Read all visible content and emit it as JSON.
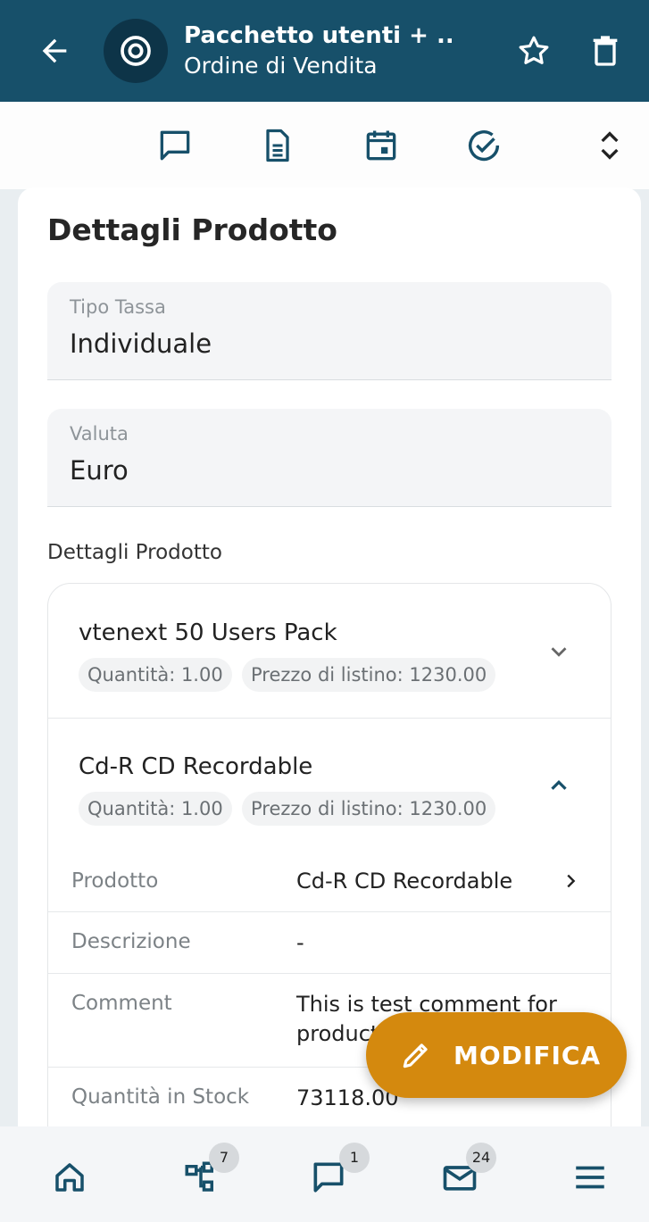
{
  "header": {
    "title": "Pacchetto utenti + ...",
    "subtitle": "Ordine di Vendita",
    "icons": {
      "back": "arrow-left-icon",
      "module": "target-icon",
      "favorite": "star-outline-icon",
      "delete": "trash-icon"
    }
  },
  "toolbar": {
    "icons": [
      "comment-icon",
      "document-icon",
      "calendar-icon",
      "check-circle-icon",
      "expand-collapse-icon"
    ]
  },
  "card": {
    "title": "Dettagli Prodotto",
    "fields": [
      {
        "label": "Tipo Tassa",
        "value": "Individuale"
      },
      {
        "label": "Valuta",
        "value": "Euro"
      }
    ],
    "section_label": "Dettagli Prodotto",
    "products": [
      {
        "name": "vtenext 50 Users Pack",
        "quantity": "Quantità: 1.00",
        "price": "Prezzo di listino: 1230.00",
        "expanded": false
      },
      {
        "name": "Cd-R CD Recordable",
        "quantity": "Quantità: 1.00",
        "price": "Prezzo di listino: 1230.00",
        "expanded": true
      }
    ],
    "details": [
      {
        "label": "Prodotto",
        "value": "Cd-R CD Recordable"
      },
      {
        "label": "Descrizione",
        "value": "-"
      },
      {
        "label": "Comment",
        "value": "This is test comment for product"
      },
      {
        "label": "Quantità in Stock",
        "value": "73118.00"
      }
    ]
  },
  "fab": {
    "label": "MODIFICA",
    "icon": "pencil-icon"
  },
  "bottom_nav": [
    {
      "icon": "home-icon",
      "badge": null
    },
    {
      "icon": "hierarchy-icon",
      "badge": "7"
    },
    {
      "icon": "comment-icon",
      "badge": "1"
    },
    {
      "icon": "mail-icon",
      "badge": "24"
    },
    {
      "icon": "menu-icon",
      "badge": null
    }
  ],
  "colors": {
    "primary": "#17506a",
    "accent": "#d4890e",
    "icon": "#17506a"
  }
}
